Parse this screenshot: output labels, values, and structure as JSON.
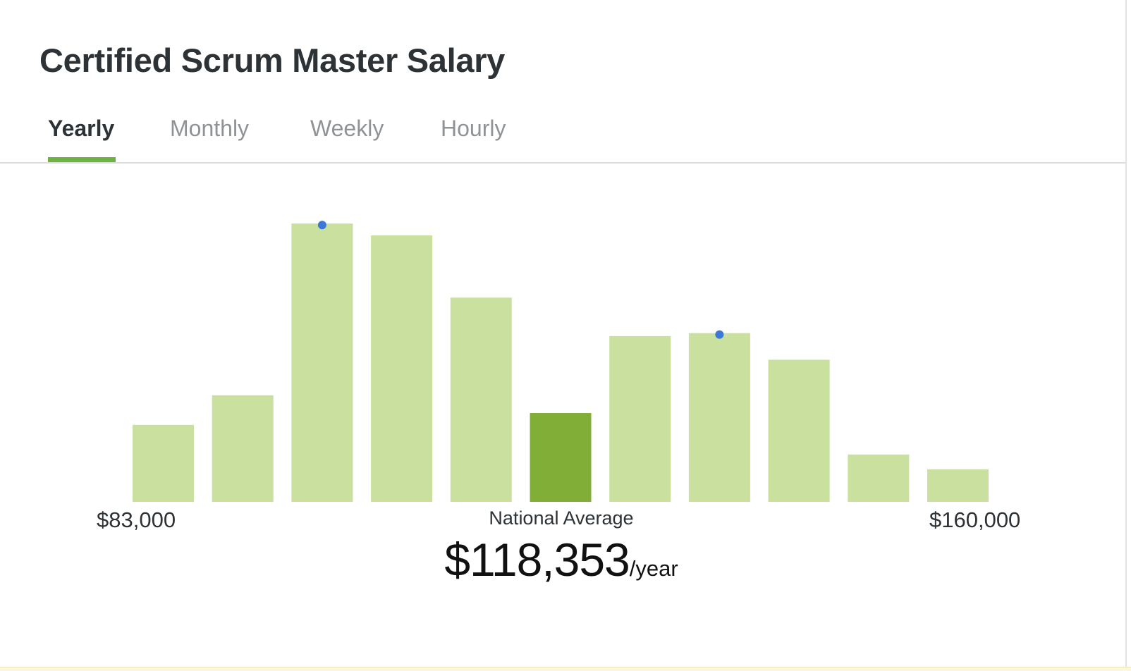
{
  "header": {
    "title": "Certified Scrum Master Salary"
  },
  "tabs": [
    {
      "label": "Yearly",
      "active": true
    },
    {
      "label": "Monthly",
      "active": false
    },
    {
      "label": "Weekly",
      "active": false
    },
    {
      "label": "Hourly",
      "active": false
    }
  ],
  "colors": {
    "accent": "#6db33f",
    "bar": "#c9e09e",
    "bar_highlight": "#80ae37",
    "marker": "#3b78d8",
    "title": "#2d3236",
    "tab_inactive": "#8f9396"
  },
  "chart_data": {
    "type": "bar",
    "values": [
      26,
      36,
      94,
      90,
      69,
      30,
      56,
      57,
      48,
      16,
      11
    ],
    "highlight_index": 5,
    "markers": [
      2,
      7
    ],
    "ylim": [
      0,
      100
    ],
    "grid": false,
    "min_label": "$83,000",
    "max_label": "$160,000"
  },
  "summary": {
    "label": "National Average",
    "value": "$118,353",
    "unit": "/year"
  }
}
